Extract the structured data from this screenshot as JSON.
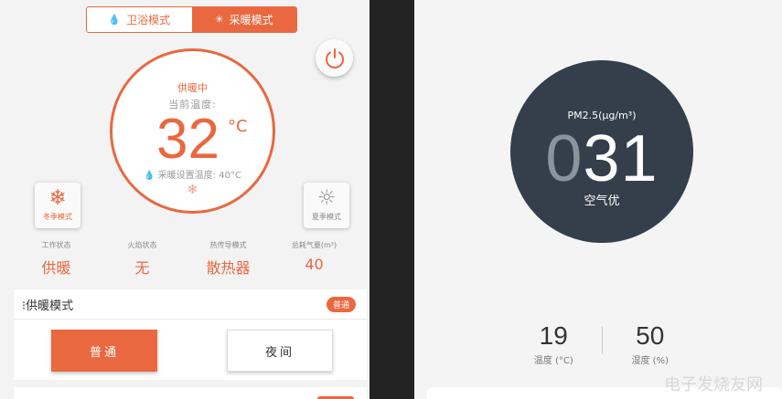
{
  "left": {
    "mode_switch": {
      "bath_label": "卫浴模式",
      "heat_label": "采暖模式"
    },
    "dial": {
      "status": "供暖中",
      "current_label": "当前温度:",
      "temperature": "32",
      "unit": "°C",
      "set_temperature": "采暖设置温度: 40°C"
    },
    "winter_button": {
      "label": "冬季模式"
    },
    "summer_button": {
      "label": "夏季模式"
    },
    "stats": [
      {
        "label": "工作状态",
        "value": "供暖"
      },
      {
        "label": "火焰状态",
        "value": "无"
      },
      {
        "label": "热传导模式",
        "value": "散热器"
      },
      {
        "label": "总耗气量(m³)",
        "value": "40"
      }
    ],
    "heating_section": {
      "title": "供暖模式",
      "badge": "普通",
      "option_normal": "普通",
      "option_night": "夜间"
    },
    "accent_color": "#e9683f"
  },
  "right": {
    "pm_label": "PM2.5(μg/m³)",
    "pm_lead_digit": "0",
    "pm_digits": "31",
    "quality": "空气优",
    "temperature": {
      "value": "19",
      "label": "温度 (°C)"
    },
    "humidity": {
      "value": "50",
      "label": "湿度 (%)"
    },
    "watermark": "电子发烧友网",
    "circle_color": "#353f4b"
  }
}
